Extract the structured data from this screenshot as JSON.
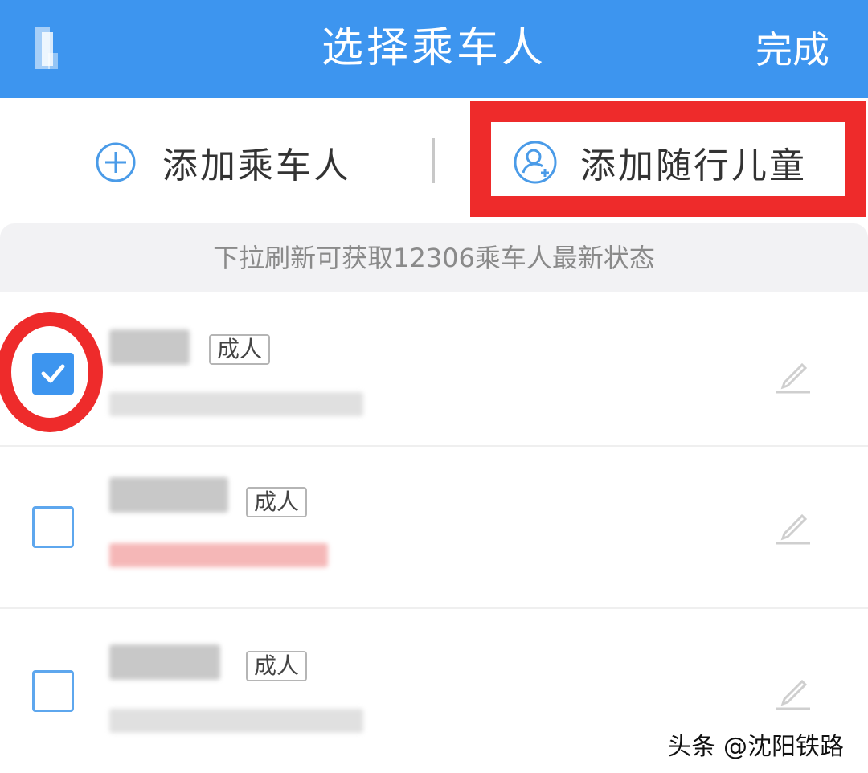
{
  "header": {
    "title": "选择乘车人",
    "done_label": "完成",
    "background": "#3d95ef"
  },
  "actions": {
    "add_passenger_label": "添加乘车人",
    "add_child_label": "添加随行儿童",
    "highlight_color": "#ee2b2b"
  },
  "hint": {
    "text": "下拉刷新可获取12306乘车人最新状态"
  },
  "passengers": [
    {
      "type_tag": "成人",
      "checked": true,
      "edit_icon": "pencil-icon"
    },
    {
      "type_tag": "成人",
      "checked": false,
      "edit_icon": "pencil-icon"
    },
    {
      "type_tag": "成人",
      "checked": false,
      "edit_icon": "pencil-icon"
    }
  ],
  "watermark": "头条 @沈阳铁路"
}
